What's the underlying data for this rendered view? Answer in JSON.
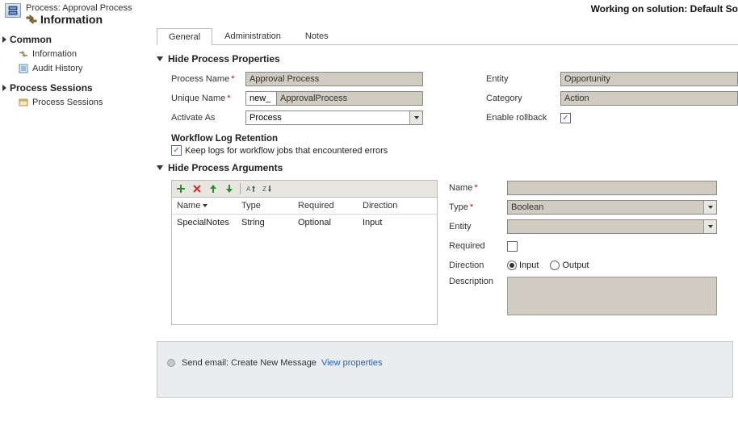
{
  "header": {
    "process_label": "Process: Approval Process",
    "info_title": "Information",
    "working_on": "Working on solution: Default So"
  },
  "sidebar": {
    "groups": [
      {
        "label": "Common",
        "items": [
          {
            "label": "Information",
            "icon": "info-icon"
          },
          {
            "label": "Audit History",
            "icon": "audit-icon"
          }
        ]
      },
      {
        "label": "Process Sessions",
        "items": [
          {
            "label": "Process Sessions",
            "icon": "sessions-icon"
          }
        ]
      }
    ]
  },
  "tabs": [
    "General",
    "Administration",
    "Notes"
  ],
  "active_tab": "General",
  "section_properties": {
    "title": "Hide Process Properties",
    "process_name_label": "Process Name",
    "process_name_value": "Approval Process",
    "unique_name_label": "Unique Name",
    "unique_name_prefix": "new_",
    "unique_name_value": "ApprovalProcess",
    "activate_as_label": "Activate As",
    "activate_as_value": "Process",
    "entity_label": "Entity",
    "entity_value": "Opportunity",
    "category_label": "Category",
    "category_value": "Action",
    "enable_rollback_label": "Enable rollback",
    "enable_rollback_checked": true,
    "wlr_title": "Workflow Log Retention",
    "wlr_checkbox_label": "Keep logs for workflow jobs that encountered errors",
    "wlr_checked": true
  },
  "section_arguments": {
    "title": "Hide Process Arguments",
    "toolbar_icons": [
      "add-icon",
      "edit-icon",
      "up-icon",
      "down-icon",
      "sort-asc-icon",
      "sort-desc-icon"
    ],
    "columns": [
      "Name",
      "Type",
      "Required",
      "Direction"
    ],
    "sort_column": "Name",
    "rows": [
      {
        "name": "SpecialNotes",
        "type": "String",
        "required": "Optional",
        "direction": "Input"
      }
    ],
    "form": {
      "name_label": "Name",
      "name_value": "",
      "type_label": "Type",
      "type_value": "Boolean",
      "entity_label": "Entity",
      "entity_value": "",
      "required_label": "Required",
      "required_checked": false,
      "direction_label": "Direction",
      "direction_value": "Input",
      "direction_options": [
        "Input",
        "Output"
      ],
      "description_label": "Description",
      "description_value": ""
    }
  },
  "steps": {
    "step1_label": "Send email:",
    "step1_value": "Create New Message",
    "step1_link": "View properties"
  }
}
